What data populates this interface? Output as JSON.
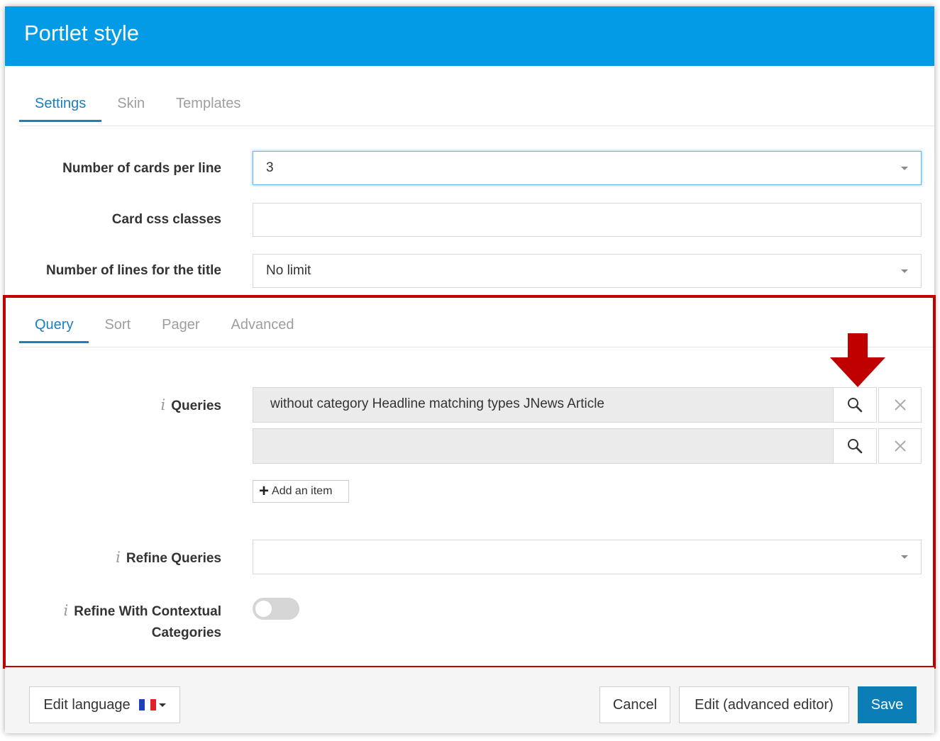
{
  "dialog": {
    "title": "Portlet style"
  },
  "main_tabs": [
    {
      "label": "Settings",
      "active": true
    },
    {
      "label": "Skin",
      "active": false
    },
    {
      "label": "Templates",
      "active": false
    }
  ],
  "settings": {
    "cards_per_line": {
      "label": "Number of cards per line",
      "value": "3"
    },
    "card_css": {
      "label": "Card css classes",
      "value": ""
    },
    "title_lines": {
      "label": "Number of lines for the title",
      "value": "No limit"
    }
  },
  "query_tabs": [
    {
      "label": "Query",
      "active": true
    },
    {
      "label": "Sort",
      "active": false
    },
    {
      "label": "Pager",
      "active": false
    },
    {
      "label": "Advanced",
      "active": false
    }
  ],
  "query": {
    "info_glyph": "i",
    "queries_label": "Queries",
    "items": [
      {
        "value": "without category Headline matching types JNews Article"
      },
      {
        "value": ""
      }
    ],
    "add_item_label": "Add an item",
    "refine_label": "Refine Queries",
    "refine_value": "",
    "contextual_label_line1": "Refine With Contextual",
    "contextual_label_line2": "Categories",
    "contextual_enabled": false
  },
  "footer": {
    "edit_language": "Edit language",
    "cancel": "Cancel",
    "advanced_editor": "Edit (advanced editor)",
    "save": "Save"
  },
  "colors": {
    "header": "#039be5",
    "accent": "#1a7fbf",
    "highlight_border": "#c00000",
    "save_button": "#0b7eb8"
  }
}
